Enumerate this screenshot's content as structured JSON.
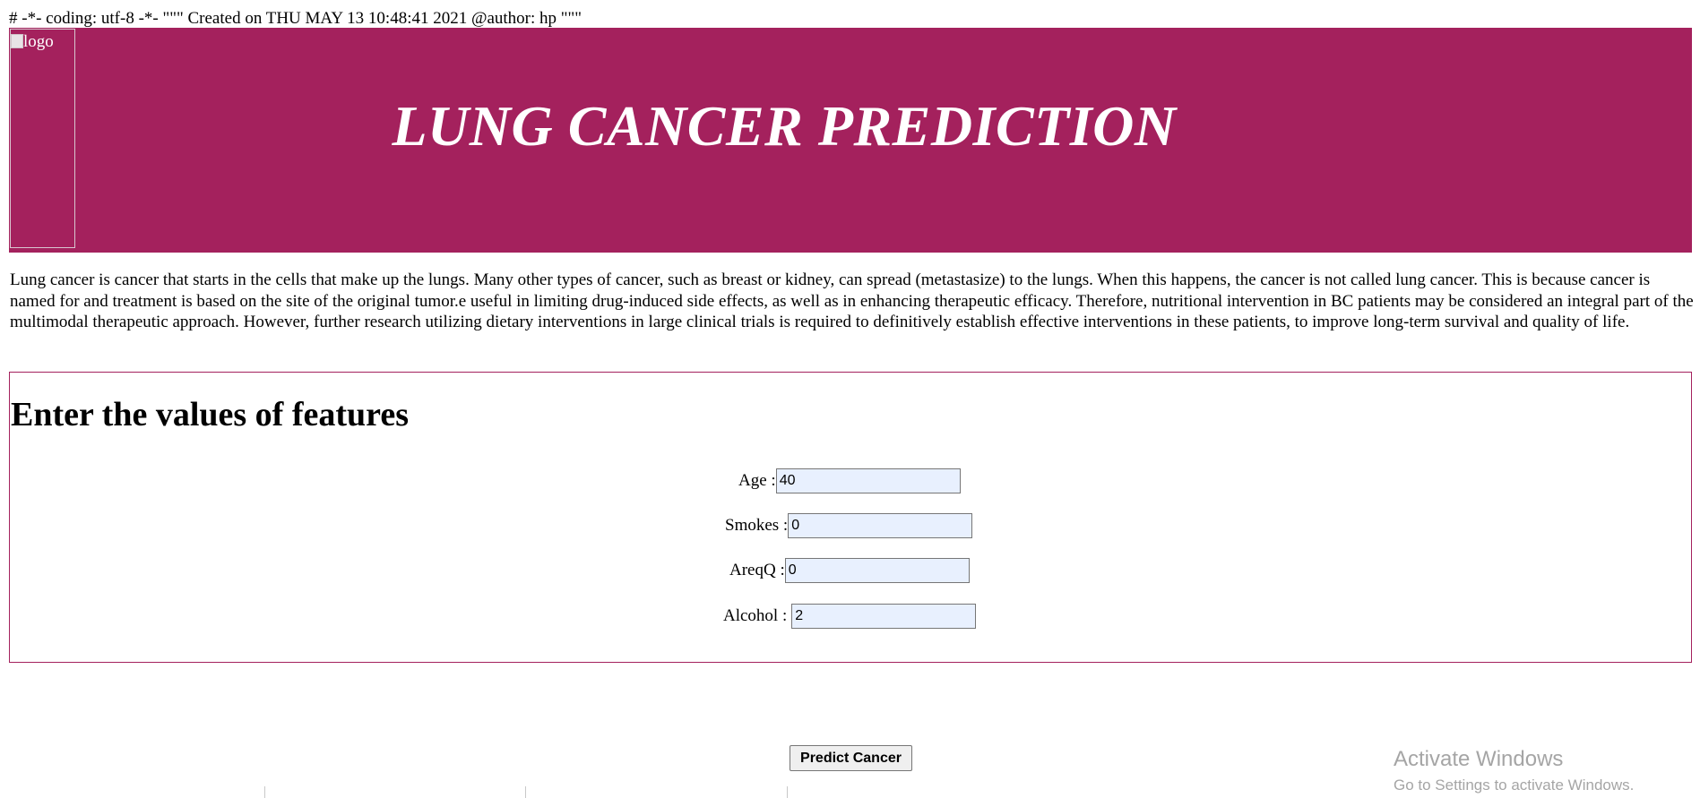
{
  "code_comment": "# -*- coding: utf-8 -*- \"\"\" Created on THU MAY 13 10:48:41 2021 @author: hp \"\"\"",
  "header": {
    "logo_alt": "logo",
    "title": "LUNG CANCER PREDICTION",
    "background_color": "#a4215d"
  },
  "intro": {
    "text": "Lung cancer is cancer that starts in the cells that make up the lungs. Many other types of cancer, such as breast or kidney, can spread (metastasize) to the lungs. When this happens, the cancer is not called lung cancer. This is because cancer is named for and treatment is based on the site of the original tumor.e useful in limiting drug-induced side effects, as well as in enhancing therapeutic efficacy. Therefore, nutritional intervention in BC patients may be considered an integral part of the multimodal therapeutic approach. However, further research utilizing dietary interventions in large clinical trials is required to definitively establish effective interventions in these patients, to improve long-term survival and quality of life."
  },
  "form": {
    "heading": "Enter the values of features",
    "fields": [
      {
        "label": "Age :",
        "value": "40"
      },
      {
        "label": "Smokes :",
        "value": "0"
      },
      {
        "label": "AreqQ :",
        "value": "0"
      },
      {
        "label": "Alcohol :",
        "value": "2"
      }
    ],
    "submit_label": "Predict Cancer"
  },
  "watermark": {
    "title": "Activate Windows",
    "subtitle": "Go to Settings to activate Windows."
  }
}
